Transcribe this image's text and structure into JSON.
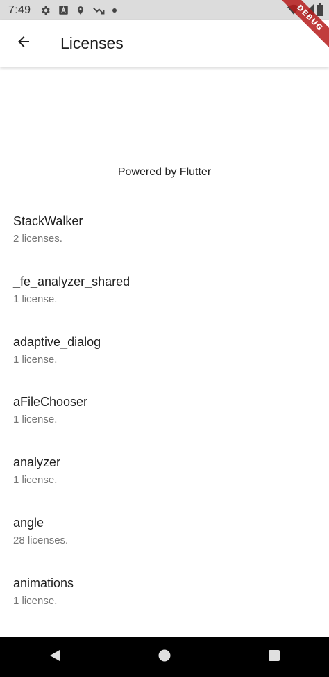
{
  "status_bar": {
    "time": "7:49",
    "icons_left": [
      "gear-icon",
      "a-icon",
      "location-icon",
      "signal-trend-icon",
      "dot-icon"
    ],
    "icons_right": [
      "wifi-icon",
      "cell-signal-icon",
      "battery-icon"
    ]
  },
  "debug_banner": {
    "label": "DEBUG",
    "color": "#b71c1c"
  },
  "app_bar": {
    "back_icon": "arrow-back-icon",
    "title": "Licenses"
  },
  "powered_by": "Powered by Flutter",
  "packages": [
    {
      "name": "StackWalker",
      "licenses": "2 licenses."
    },
    {
      "name": "_fe_analyzer_shared",
      "licenses": "1 license."
    },
    {
      "name": "adaptive_dialog",
      "licenses": "1 license."
    },
    {
      "name": "aFileChooser",
      "licenses": "1 license."
    },
    {
      "name": "analyzer",
      "licenses": "1 license."
    },
    {
      "name": "angle",
      "licenses": "28 licenses."
    },
    {
      "name": "animations",
      "licenses": "1 license."
    }
  ],
  "nav_bar": {
    "buttons": [
      "back-triangle-icon",
      "home-circle-icon",
      "recents-square-icon"
    ]
  },
  "colors": {
    "status_bar_bg": "#dcdcdc",
    "subtitle": "#757575",
    "title": "#1f1f1f",
    "nav_bg": "#000000"
  }
}
